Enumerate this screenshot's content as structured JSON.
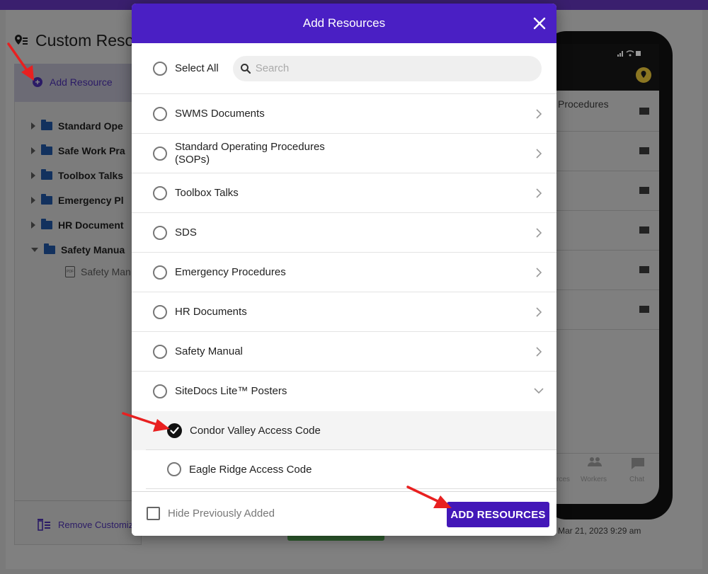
{
  "background": {
    "page_title": "Custom Reso",
    "add_resource": "Add Resource",
    "tree": [
      {
        "label": "Standard Ope",
        "expanded": false
      },
      {
        "label": "Safe Work Pra",
        "expanded": false
      },
      {
        "label": "Toolbox Talks",
        "expanded": false
      },
      {
        "label": "Emergency Pl",
        "expanded": false
      },
      {
        "label": "HR Document",
        "expanded": false
      },
      {
        "label": "Safety Manua",
        "expanded": true
      }
    ],
    "tree_child": "Safety Man",
    "pdf_badge": "PDF",
    "remove_custom": "Remove Customiz",
    "date": "Mar 21, 2023 9:29 am",
    "phone": {
      "first_row": "Procedures",
      "nav": [
        "rces",
        "Workers",
        "Chat"
      ]
    }
  },
  "modal": {
    "title": "Add Resources",
    "select_all": "Select All",
    "search_placeholder": "Search",
    "search_value": "",
    "categories": [
      {
        "label": "SWMS Documents",
        "expanded": false
      },
      {
        "label": "Standard Operating Procedures (SOPs)",
        "expanded": false
      },
      {
        "label": "Toolbox Talks",
        "expanded": false
      },
      {
        "label": "SDS",
        "expanded": false
      },
      {
        "label": "Emergency Procedures",
        "expanded": false
      },
      {
        "label": "HR Documents",
        "expanded": false
      },
      {
        "label": "Safety Manual",
        "expanded": false
      },
      {
        "label": "SiteDocs Lite™ Posters",
        "expanded": true
      }
    ],
    "sub_items": [
      {
        "label": "Condor Valley Access Code",
        "checked": true
      },
      {
        "label": "Eagle Ridge Access Code",
        "checked": false
      }
    ],
    "hide_previously_added": "Hide Previously Added",
    "hide_previously_added_checked": false,
    "add_button": "ADD RESOURCES"
  },
  "colors": {
    "modal_header": "#4a1fc4",
    "primary_button": "#4317b8",
    "annotation_arrow": "#e82020"
  }
}
